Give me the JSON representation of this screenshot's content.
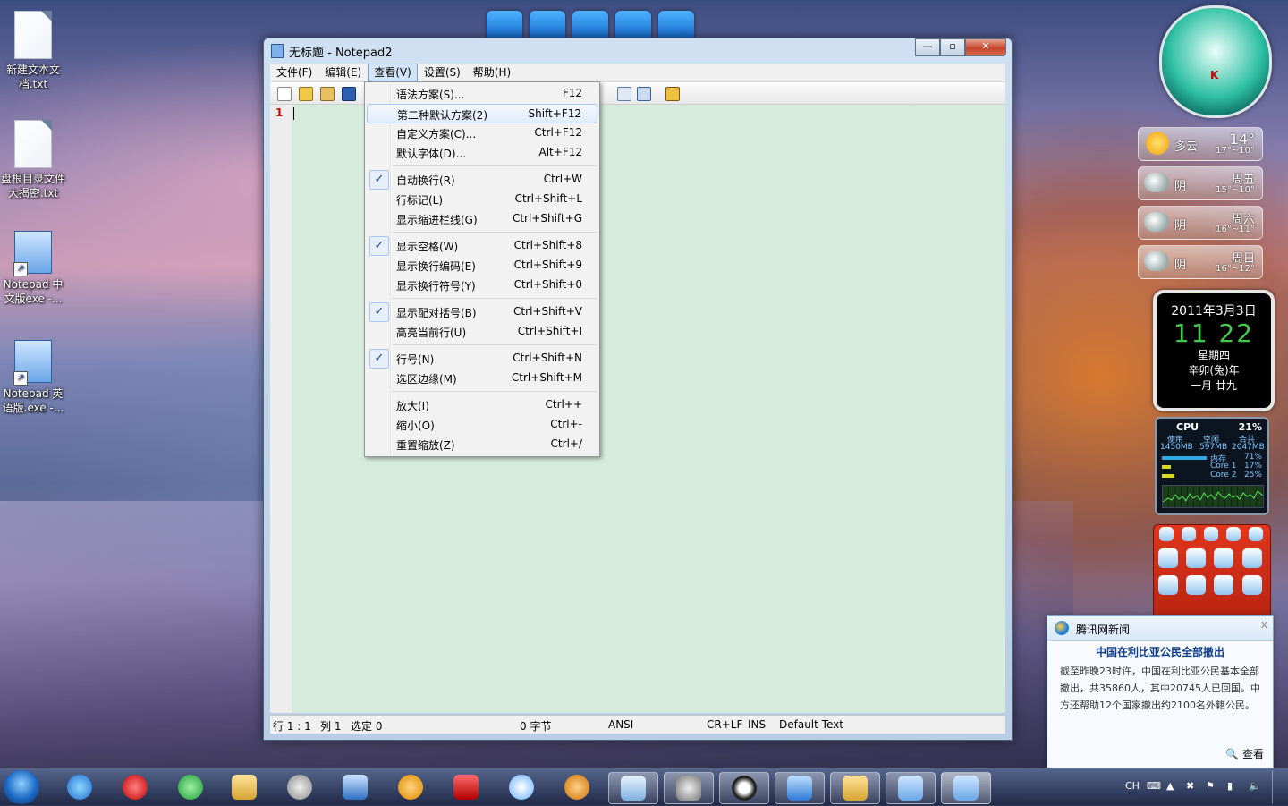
{
  "desktop_icons": [
    {
      "label": "新建文本文档.txt",
      "type": "text-file"
    },
    {
      "label": "盘根目录文件大揭密.txt",
      "type": "text-file"
    },
    {
      "label": "Notepad 中文版exe -...",
      "type": "shortcut"
    },
    {
      "label": "Notepad 英语版.exe -...",
      "type": "shortcut"
    }
  ],
  "window": {
    "title": "无标题 - Notepad2",
    "controls": {
      "minimize": "—",
      "maximize": "▫",
      "close": "✕"
    }
  },
  "menubar": {
    "items": [
      "文件(F)",
      "编辑(E)",
      "查看(V)",
      "设置(S)",
      "帮助(H)"
    ],
    "active": "查看(V)"
  },
  "toolbar": {
    "icons": [
      "new-file-icon",
      "open-file-icon",
      "browse-icon",
      "save-icon",
      "scheme-config-icon",
      "line-select-icon",
      "exit-icon"
    ]
  },
  "editor": {
    "line_number": "1",
    "background": "#d5ebdc"
  },
  "statusbar": {
    "position": "行 1 : 1",
    "column": "列 1",
    "selection": "选定 0",
    "size": "0 字节",
    "encoding": "ANSI",
    "eol": "CR+LF",
    "mode": "INS",
    "scheme": "Default Text"
  },
  "view_menu": {
    "groups": [
      [
        {
          "label": "语法方案(S)...",
          "shortcut": "F12",
          "checked": false
        },
        {
          "label": "第二种默认方案(2)",
          "shortcut": "Shift+F12",
          "checked": false,
          "highlighted": true
        },
        {
          "label": "自定义方案(C)...",
          "shortcut": "Ctrl+F12",
          "checked": false
        },
        {
          "label": "默认字体(D)...",
          "shortcut": "Alt+F12",
          "checked": false
        }
      ],
      [
        {
          "label": "自动换行(R)",
          "shortcut": "Ctrl+W",
          "checked": true
        },
        {
          "label": "行标记(L)",
          "shortcut": "Ctrl+Shift+L",
          "checked": false
        },
        {
          "label": "显示缩进栏线(G)",
          "shortcut": "Ctrl+Shift+G",
          "checked": false
        }
      ],
      [
        {
          "label": "显示空格(W)",
          "shortcut": "Ctrl+Shift+8",
          "checked": true
        },
        {
          "label": "显示换行编码(E)",
          "shortcut": "Ctrl+Shift+9",
          "checked": false
        },
        {
          "label": "显示换行符号(Y)",
          "shortcut": "Ctrl+Shift+0",
          "checked": false
        }
      ],
      [
        {
          "label": "显示配对括号(B)",
          "shortcut": "Ctrl+Shift+V",
          "checked": true
        },
        {
          "label": "高亮当前行(U)",
          "shortcut": "Ctrl+Shift+I",
          "checked": false
        }
      ],
      [
        {
          "label": "行号(N)",
          "shortcut": "Ctrl+Shift+N",
          "checked": true
        },
        {
          "label": "选区边缘(M)",
          "shortcut": "Ctrl+Shift+M",
          "checked": false
        }
      ],
      [
        {
          "label": "放大(I)",
          "shortcut": "Ctrl++",
          "checked": false
        },
        {
          "label": "缩小(O)",
          "shortcut": "Ctrl+-",
          "checked": false
        },
        {
          "label": "重置缩放(Z)",
          "shortcut": "Ctrl+/",
          "checked": false
        }
      ]
    ],
    "check_glyph": "✓"
  },
  "weather": [
    {
      "cond": "多云",
      "temp": "14°",
      "range": "17°~10°",
      "icon": "sun-cloud-icon"
    },
    {
      "cond": "阴",
      "day": "周五",
      "range": "15°~10°",
      "icon": "cloud-icon"
    },
    {
      "cond": "阴",
      "day": "周六",
      "range": "16°~11°",
      "icon": "cloud-icon"
    },
    {
      "cond": "阴",
      "day": "周日",
      "range": "16°~12°",
      "icon": "cloud-icon"
    }
  ],
  "calendar_clock": {
    "date": "2011年3月3日",
    "hour": "11",
    "minute": "22",
    "weekday": "星期四",
    "lunar_year": "辛卯(兔)年",
    "lunar_day": "一月 廿九"
  },
  "cpu_meter": {
    "title": "CPU",
    "cpu_percent": "21%",
    "headers": [
      "使用",
      "空闲",
      "合共"
    ],
    "mem": [
      "1450MB",
      "597MB",
      "2047MB"
    ],
    "rows": [
      {
        "label": "内存",
        "value": "71%"
      },
      {
        "label": "Core 1",
        "value": "17%"
      },
      {
        "label": "Core 2",
        "value": "25%"
      }
    ]
  },
  "news": {
    "source": "腾讯网新闻",
    "close": "x",
    "headline": "中国在利比亚公民全部撤出",
    "body": "截至昨晚23时许，中国在利比亚公民基本全部撤出，共35860人，其中20745人已回国。中方还帮助12个国家撤出约2100名外籍公民。",
    "more": "查看"
  },
  "taskbar": {
    "tray": {
      "lang": "CH"
    }
  }
}
